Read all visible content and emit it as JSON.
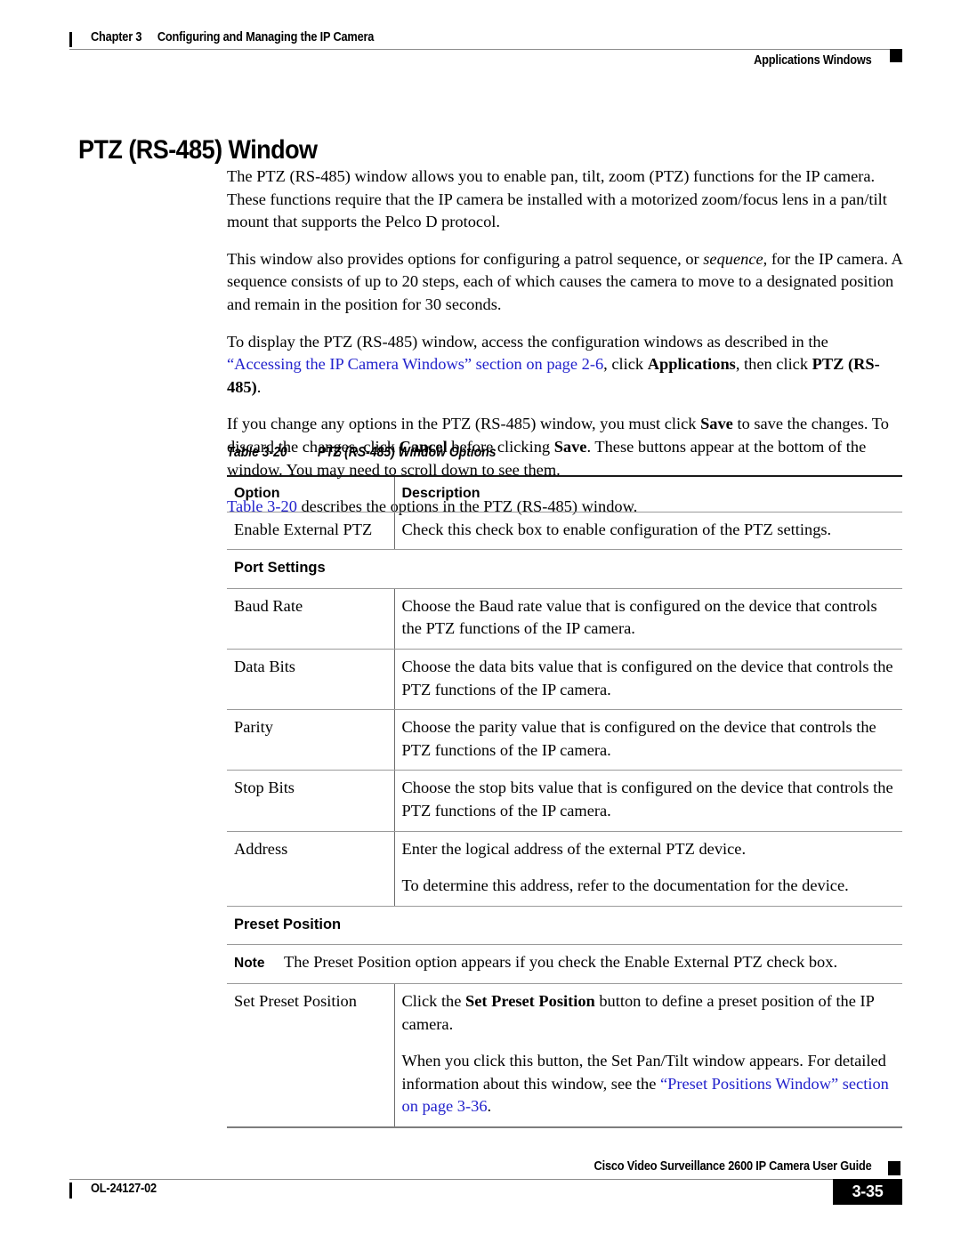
{
  "header": {
    "left_bar": "|",
    "chapter_num": "Chapter 3",
    "chapter_title": "Configuring and Managing the IP Camera",
    "section": "Applications Windows"
  },
  "title": "PTZ (RS-485) Window",
  "paragraphs": {
    "p1": "The PTZ (RS-485) window allows you to enable pan, tilt, zoom (PTZ) functions for the IP camera. These functions require that the IP camera be installed with a motorized zoom/focus lens in a pan/tilt mount that supports the Pelco D protocol.",
    "p2_a": "This window also provides options for configuring a patrol sequence, or ",
    "p2_italic": "sequence",
    "p2_b": ", for the IP camera. A sequence consists of up to 20 steps, each of which causes the camera to move to a designated position and remain in the position for 30 seconds.",
    "p3_a": "To display the PTZ (RS-485) window, access the configuration windows as described in the ",
    "p3_link": "“Accessing the IP Camera Windows” section on page 2-6",
    "p3_b": ", click ",
    "p3_bold1": "Applications",
    "p3_c": ", then click ",
    "p3_bold2": "PTZ (RS-485)",
    "p3_d": ".",
    "p4_a": "If you change any options in the PTZ (RS-485) window, you must click ",
    "p4_bold1": "Save",
    "p4_b": " to save the changes. To discard the changes, click ",
    "p4_bold2": "Cancel",
    "p4_c": " before clicking ",
    "p4_bold3": "Save",
    "p4_d": ". These buttons appear at the bottom of the window. You may need to scroll down to see them.",
    "p5_link": "Table 3-20",
    "p5_text": " describes the options in the PTZ (RS-485) window."
  },
  "table": {
    "caption_number": "Table 3-20",
    "caption_title": "PTZ (RS-485) Window Options",
    "columns": [
      "Option",
      "Description"
    ],
    "rows": [
      {
        "kind": "data",
        "option": "Enable External PTZ",
        "description": [
          "Check this check box to enable configuration of the PTZ settings."
        ]
      },
      {
        "kind": "section",
        "option": "Port Settings"
      },
      {
        "kind": "data",
        "option": "Baud Rate",
        "description": [
          "Choose the Baud rate value that is configured on the device that controls the PTZ functions of the IP camera."
        ]
      },
      {
        "kind": "data",
        "option": "Data Bits",
        "description": [
          "Choose the data bits value that is configured on the device that controls the PTZ functions of the IP camera."
        ]
      },
      {
        "kind": "data",
        "option": "Parity",
        "description": [
          "Choose the parity value that is configured on the device that controls the PTZ functions of the IP camera."
        ]
      },
      {
        "kind": "data",
        "option": "Stop Bits",
        "description": [
          "Choose the stop bits value that is configured on the device that controls the PTZ functions of the IP camera."
        ]
      },
      {
        "kind": "data",
        "option": "Address",
        "description": [
          "Enter the logical address of the external PTZ device.",
          "To determine this address, refer to the documentation for the device."
        ]
      },
      {
        "kind": "section",
        "option": "Preset Position"
      },
      {
        "kind": "note",
        "note_label": "Note",
        "note_text": "The Preset Position option appears if you check the Enable External PTZ check box."
      },
      {
        "kind": "last",
        "option": "Set Preset Position",
        "desc_p1_a": "Click the ",
        "desc_p1_bold": "Set Preset Position",
        "desc_p1_b": " button to define a preset position of the IP camera.",
        "desc_p2_a": "When you click this button, the Set Pan/Tilt window appears. For detailed information about this window, see the ",
        "desc_p2_link": "“Preset Positions Window” section on page 3-36",
        "desc_p2_b": "."
      }
    ]
  },
  "footer": {
    "guide_title": "Cisco Video Surveillance 2600 IP Camera User Guide",
    "doc_id": "OL-24127-02",
    "page_number": "3-35"
  },
  "colors": {
    "link": "#2222cc",
    "rule": "#8c8c8c",
    "text": "#000000"
  }
}
